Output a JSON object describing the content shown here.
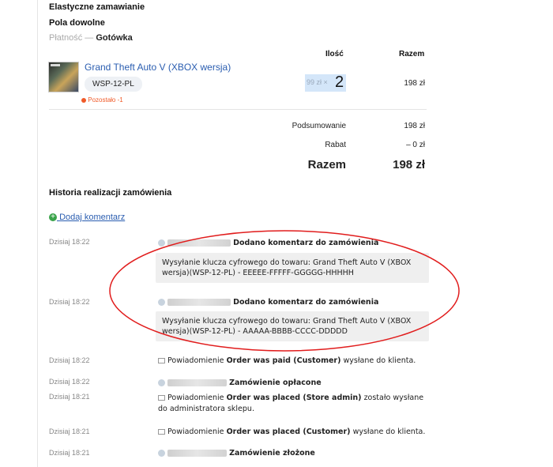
{
  "details": {
    "flexible_order": "Elastyczne zamawianie",
    "custom_fields": "Pola dowolne",
    "payment_label": "Płatność",
    "payment_sep": "—",
    "payment_value": "Gotówka"
  },
  "table": {
    "qty_header": "Ilość",
    "total_header": "Razem"
  },
  "item": {
    "name": "Grand Theft Auto V (XBOX wersja)",
    "sku": "WSP-12-PL",
    "stock_note": "Pozostało -1",
    "unit_price": "99 zł ×",
    "qty": "2",
    "line_total": "198 zł"
  },
  "summary": {
    "subtotal_label": "Podsumowanie",
    "subtotal_value": "198 zł",
    "discount_label": "Rabat",
    "discount_value": "– 0 zł",
    "total_label": "Razem",
    "total_value": "198 zł"
  },
  "history": {
    "title": "Historia realizacji zamówienia",
    "add_comment": "Dodaj komentarz",
    "events": [
      {
        "time": "Dzisiaj 18:22",
        "text": "Dodano komentarz do zamówienia",
        "comment": "Wysyłanie klucza cyfrowego do towaru: Grand Theft Auto V (XBOX wersja)(WSP-12-PL) - EEEEE-FFFFF-GGGGG-HHHHH"
      },
      {
        "time": "Dzisiaj 18:22",
        "text": "Dodano komentarz do zamówienia",
        "comment": "Wysyłanie klucza cyfrowego do towaru: Grand Theft Auto V (XBOX wersja)(WSP-12-PL) - AAAAA-BBBB-CCCC-DDDDD"
      },
      {
        "time": "Dzisiaj 18:22",
        "pre": "Powiadomienie",
        "bold": "Order was paid (Customer)",
        "post": "wysłane do klienta."
      },
      {
        "time": "Dzisiaj 18:22",
        "text": "Zamówienie opłacone"
      },
      {
        "time": "Dzisiaj 18:21",
        "pre": "Powiadomienie",
        "bold": "Order was placed (Store admin)",
        "post": "zostało wysłane do administratora sklepu."
      },
      {
        "time": "Dzisiaj 18:21",
        "pre": "Powiadomienie",
        "bold": "Order was placed (Customer)",
        "post": "wysłane do klienta."
      },
      {
        "time": "Dzisiaj 18:21",
        "text": "Zamówienie złożone"
      }
    ]
  },
  "colors": {
    "link": "#2a5db0",
    "annotation": "#e11d1d",
    "add_icon": "#3aa34a",
    "stock_dot": "#f05a28"
  }
}
